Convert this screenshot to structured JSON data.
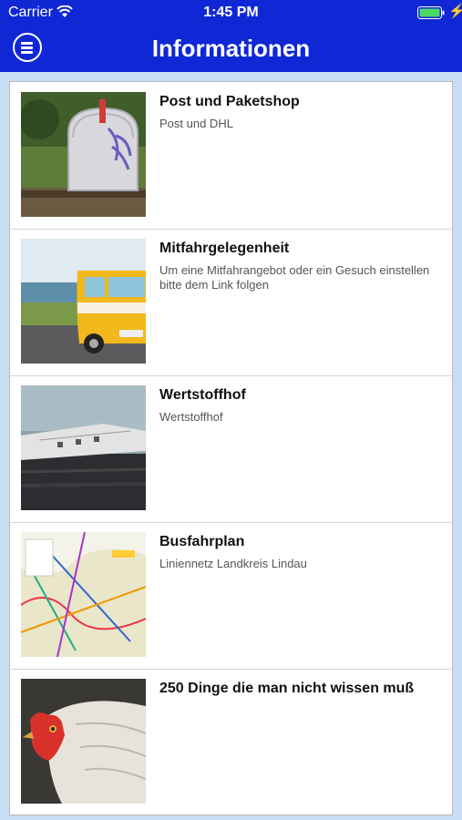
{
  "status_bar": {
    "carrier": "Carrier",
    "time": "1:45 PM"
  },
  "header": {
    "title": "Informationen",
    "menu_icon": "hamburger-circle-icon"
  },
  "colors": {
    "header_bg": "#1027d6",
    "page_bg": "#c9dcf5",
    "battery": "#4cd964"
  },
  "items": [
    {
      "title": "Post und Paketshop",
      "subtitle": "Post und DHL",
      "image": "mailbox-photo"
    },
    {
      "title": "Mitfahrgelegenheit",
      "subtitle": "Um eine Mitfahrangebot oder ein Gesuch einstellen bitte dem Link folgen",
      "image": "yellow-van-photo"
    },
    {
      "title": "Wertstoffhof",
      "subtitle": "Wertstoffhof",
      "image": "plane-wreck-photo"
    },
    {
      "title": "Busfahrplan",
      "subtitle": "Liniennetz Landkreis Lindau",
      "image": "bus-map-photo"
    },
    {
      "title": "250 Dinge die man nicht wissen muß",
      "subtitle": "",
      "image": "chicken-photo"
    }
  ]
}
